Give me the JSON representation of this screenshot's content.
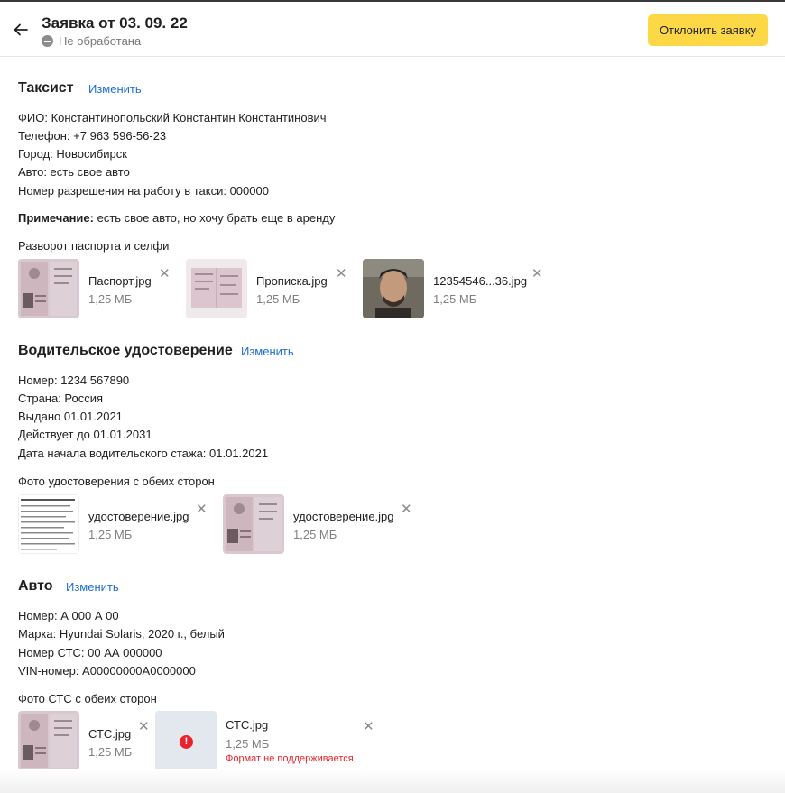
{
  "header": {
    "title": "Заявка от 03. 09. 22",
    "status": "Не обработана",
    "decline_label": "Отклонить заявку"
  },
  "taxi": {
    "title": "Таксист",
    "edit": "Изменить",
    "lines": [
      "ФИО: Константинопольский Константин Константинович",
      "Телефон: +7 963 596-56-23",
      "Город: Новосибирск",
      "Авто: есть свое авто",
      "Номер разрешения на работу в такси: 000000"
    ],
    "note_label": "Примечание:",
    "note_text": " есть свое авто, но хочу брать еще в аренду",
    "files_label": "Разворот паспорта и селфи",
    "files": [
      {
        "name": "Паспорт.jpg",
        "size": "1,25 МБ"
      },
      {
        "name": "Прописка.jpg",
        "size": "1,25 МБ"
      },
      {
        "name": "12354546...36.jpg",
        "size": "1,25 МБ"
      }
    ]
  },
  "license": {
    "title": "Водительское удостоверение",
    "edit": "Изменить",
    "lines": [
      "Номер: 1234 567890",
      "Страна: Россия",
      "Выдано 01.01.2021",
      "Действует до 01.01.2031",
      "Дата начала водительского стажа: 01.01.2021"
    ],
    "files_label": "Фото удостоверения с обеих сторон",
    "files": [
      {
        "name": "удостоверение.jpg",
        "size": "1,25 МБ"
      },
      {
        "name": "удостоверение.jpg",
        "size": "1,25 МБ"
      }
    ]
  },
  "car": {
    "title": "Авто",
    "edit": "Изменить",
    "lines": [
      "Номер: А 000 А 00",
      "Марка: Hyundai Solaris, 2020 г., белый",
      "Номер СТС: 00 АА 000000",
      "VIN-номер: A00000000A0000000"
    ],
    "files_label": "Фото СТС с обеих сторон",
    "files": [
      {
        "name": "СТС.jpg",
        "size": "1,25 МБ"
      },
      {
        "name": "СТС.jpg",
        "size": "1,25 МБ",
        "error": "Формат не поддерживается"
      }
    ]
  },
  "icons": {
    "back": "arrow-left-icon",
    "status": "minus-circle-icon",
    "close": "close-icon",
    "error": "exclamation-circle-icon"
  },
  "colors": {
    "accent": "#fcd846",
    "link": "#1f6fd1",
    "error": "#e8232b"
  }
}
